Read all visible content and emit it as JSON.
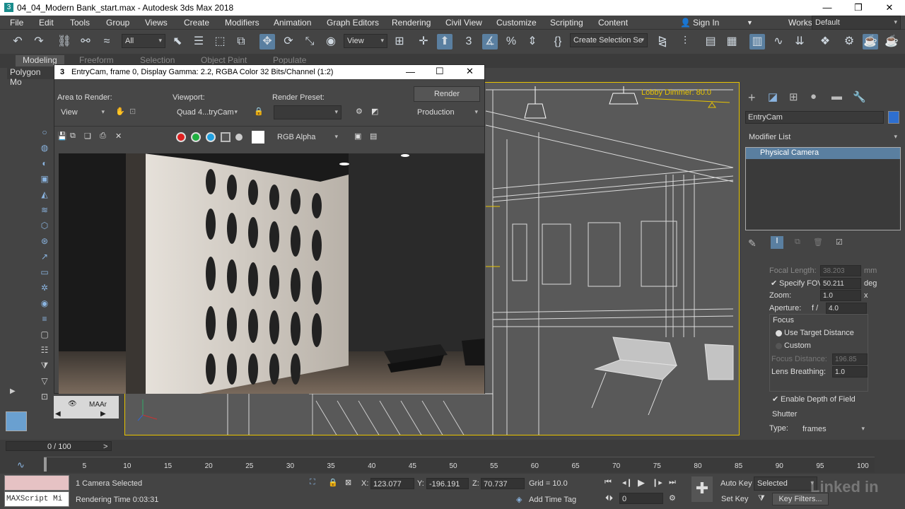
{
  "window": {
    "title": "04_04_Modern Bank_start.max - Autodesk 3ds Max 2018",
    "app_icon": "3"
  },
  "menu": [
    "File",
    "Edit",
    "Tools",
    "Group",
    "Views",
    "Create",
    "Modifiers",
    "Animation",
    "Graph Editors",
    "Rendering",
    "Civil View",
    "Customize",
    "Scripting",
    "Content"
  ],
  "signin": "Sign In",
  "workspaces_label": "Workspaces:",
  "workspaces_value": "Default",
  "toolbar": {
    "filter": "All",
    "refcoord": "View",
    "selection_set": "Create Selection Se",
    "snap_label": "3"
  },
  "ribbon": {
    "tabs": [
      "Modeling",
      "Freeform",
      "Selection",
      "Object Paint",
      "Populate"
    ],
    "sub": "Polygon Mo"
  },
  "render_frame": {
    "title": "EntryCam, frame 0, Display Gamma: 2.2, RGBA Color 32 Bits/Channel (1:2)",
    "area_label": "Area to Render:",
    "area_value": "View",
    "viewport_label": "Viewport:",
    "viewport_value": "Quad 4...tryCam",
    "preset_label": "Render Preset:",
    "preset_value": "",
    "render_button": "Render",
    "production": "Production",
    "channel": "RGB Alpha"
  },
  "viewport": {
    "light_label": "Lobby Dimmer: 80.0",
    "scene_item": "MAAr"
  },
  "command_panel": {
    "object_name": "EntryCam",
    "modifier_list": "Modifier List",
    "stack_item": "Physical Camera",
    "focal_length_label": "Focal Length:",
    "focal_length": "38.203",
    "focal_unit": "mm",
    "specify_fov": "Specify FOV:",
    "fov": "50.211",
    "fov_unit": "deg",
    "zoom_label": "Zoom:",
    "zoom": "1.0",
    "zoom_unit": "x",
    "aperture_label": "Aperture:",
    "aperture_prefix": "f /",
    "aperture": "4.0",
    "focus_group": "Focus",
    "use_target": "Use Target Distance",
    "custom": "Custom",
    "focus_dist_label": "Focus Distance:",
    "focus_dist": "196.85",
    "lens_breathing_label": "Lens Breathing:",
    "lens_breathing": "1.0",
    "enable_dof": "Enable Depth of Field",
    "shutter_group": "Shutter",
    "type_label": "Type:",
    "type_value": "frames"
  },
  "timeline": {
    "counter": "0 / 100",
    "ticks": [
      "5",
      "10",
      "15",
      "20",
      "25",
      "30",
      "35",
      "40",
      "45",
      "50",
      "55",
      "60",
      "65",
      "70",
      "75",
      "80",
      "85",
      "90",
      "95",
      "100"
    ]
  },
  "status": {
    "maxscript": "MAXScript Mi",
    "selected": "1 Camera Selected",
    "render_time": "Rendering Time  0:03:31",
    "x_label": "X:",
    "x": "123.077",
    "y_label": "Y:",
    "y": "-196.191",
    "z_label": "Z:",
    "z": "70.737",
    "grid": "Grid = 10.0",
    "add_time_tag": "Add Time Tag",
    "frame": "0",
    "auto_key": "Auto Key",
    "selected_drop": "Selected",
    "set_key": "Set Key",
    "key_filters": "Key Filters...",
    "watermark": "Linked in"
  }
}
